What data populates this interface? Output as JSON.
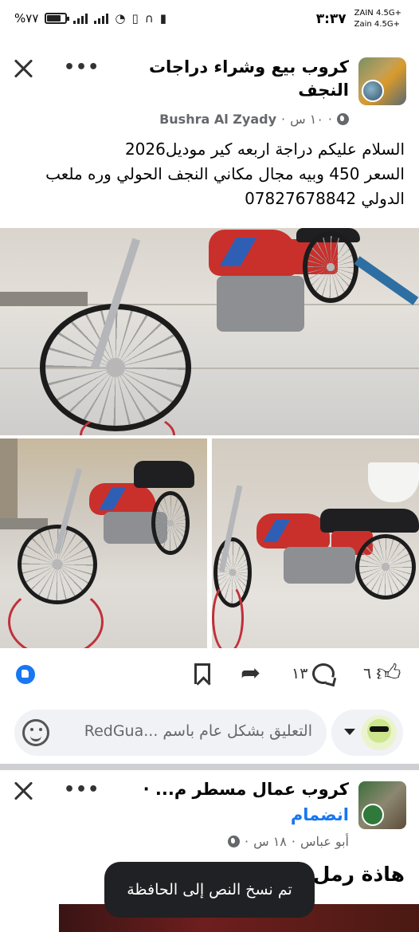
{
  "status_bar": {
    "battery": "%٧٧",
    "time": "٣:٣٧",
    "network_1": "ZAIN 4.5G+",
    "network_2": "Zain 4.5G+",
    "battery_level": 0.77
  },
  "post": {
    "group_name": "كروب بيع وشراء دراجات النجف",
    "author": "Bushra Al Zyady",
    "time": "١٠ س",
    "text_lines": [
      "السلام عليكم  دراجة اربعه كير موديل2026",
      "السعر 450 وبيه مجال مكاني النجف الحولي وره ملعب",
      "الدولي 07827678842"
    ],
    "icons": {
      "close": "close-icon",
      "more": "more-icon",
      "visibility": "globe-icon"
    }
  },
  "reactions": {
    "like_count": "٦",
    "comment_count": "١٣"
  },
  "composer": {
    "placeholder": "التعليق بشكل عام باسم ...RedGua"
  },
  "post2": {
    "group_name": "كروب عمال مسطر م... ·",
    "join_label": "انضمام",
    "author": "أبو عباس",
    "time": "١٨ س",
    "text": "هاذة رمل ... بلاش"
  },
  "toast": {
    "message": "تم نسخ النص إلى الحافظة"
  },
  "colors": {
    "brand_blue": "#1877f2",
    "meta_gray": "#65676b",
    "toast_bg": "#202124"
  }
}
